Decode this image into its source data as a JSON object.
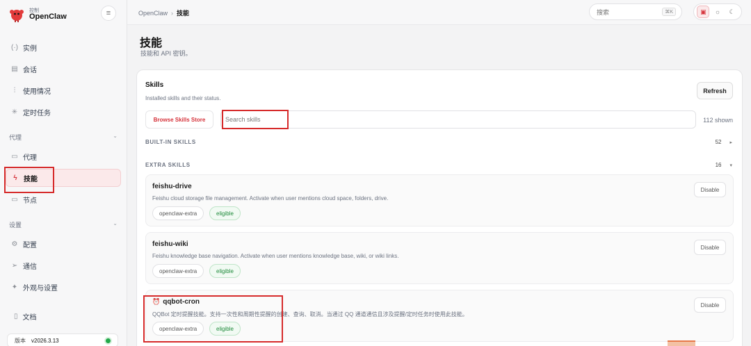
{
  "brand": {
    "sub": "控制",
    "name": "OpenClaw",
    "logo_icon": "lobster-logo-icon",
    "accent": "#d6343c"
  },
  "sidebar": {
    "top_items": [
      {
        "label": "实例",
        "icon": "broadcast-icon"
      },
      {
        "label": "会话",
        "icon": "document-icon"
      },
      {
        "label": "使用情况",
        "icon": "bar-chart-icon"
      },
      {
        "label": "定时任务",
        "icon": "loader-icon"
      }
    ],
    "agent_section": "代理",
    "agent_items": [
      {
        "label": "代理",
        "icon": "folder-icon"
      },
      {
        "label": "技能",
        "icon": "lightning-icon",
        "active": true
      },
      {
        "label": "节点",
        "icon": "monitor-icon"
      }
    ],
    "settings_section": "设置",
    "settings_items": [
      {
        "label": "配置",
        "icon": "gear-icon"
      },
      {
        "label": "通信",
        "icon": "send-icon"
      },
      {
        "label": "外观与设置",
        "icon": "sparkle-icon"
      }
    ],
    "docs_label": "文档",
    "version_label": "版本",
    "version": "v2026.3.13"
  },
  "topbar": {
    "breadcrumb_root": "OpenClaw",
    "breadcrumb_current": "技能",
    "search_placeholder": "搜索",
    "search_shortcut": "⌘K"
  },
  "main": {
    "title": "技能",
    "subtitle": "技能和 API 密钥。",
    "card": {
      "title": "Skills",
      "subtitle": "Installed skills and their status.",
      "refresh_label": "Refresh",
      "store_label": "Browse Skills Store",
      "search_placeholder": "Search skills",
      "shown": "112 shown",
      "builtin_label": "BUILT-IN SKILLS",
      "builtin_count": "52",
      "extra_label": "EXTRA SKILLS",
      "extra_count": "16"
    },
    "skills": [
      {
        "name": "feishu-drive",
        "emoji": "",
        "desc": "Feishu cloud storage file management. Activate when user mentions cloud space, folders, drive.",
        "source": "openclaw-extra",
        "status": "eligible",
        "action": "Disable"
      },
      {
        "name": "feishu-wiki",
        "emoji": "",
        "desc": "Feishu knowledge base navigation. Activate when user mentions knowledge base, wiki, or wiki links.",
        "source": "openclaw-extra",
        "status": "eligible",
        "action": "Disable"
      },
      {
        "name": "qqbot-cron",
        "emoji": "⏰",
        "desc": "QQBot 定时提醒技能。支持一次性和周期性提醒的创建、查询、取消。当通过 QQ 通道通信且涉及提醒/定时任务时使用此技能。",
        "source": "openclaw-extra",
        "status": "eligible",
        "action": "Disable"
      }
    ]
  }
}
